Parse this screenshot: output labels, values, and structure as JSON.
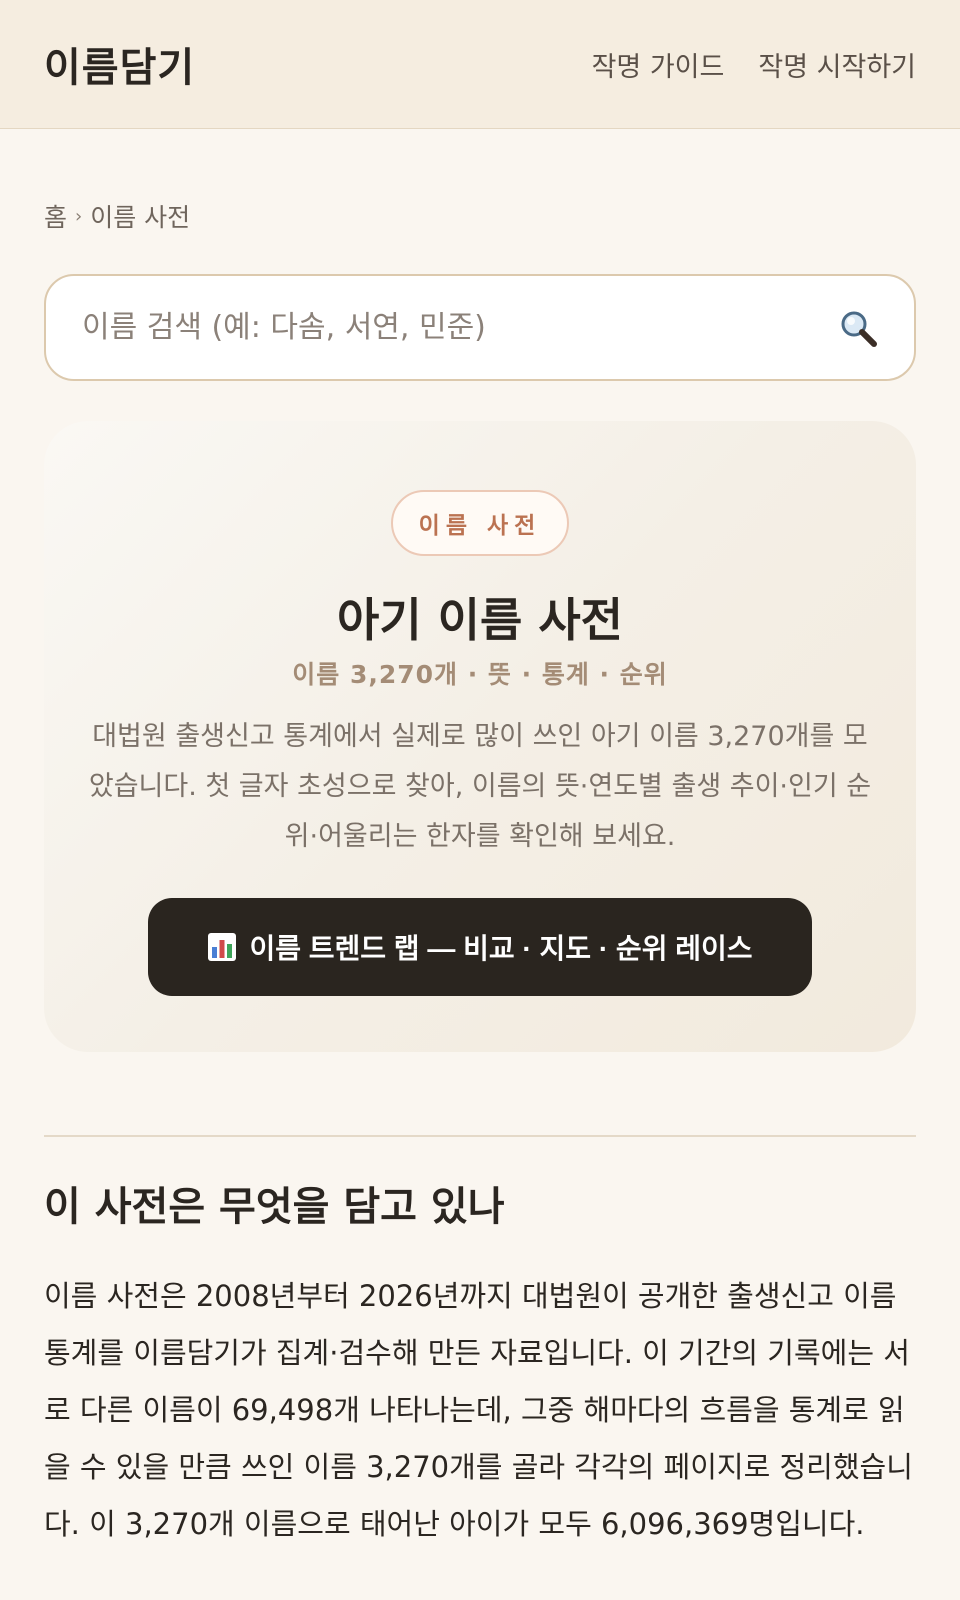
{
  "header": {
    "logo": "이름담기",
    "nav": [
      "작명 가이드",
      "작명 시작하기"
    ]
  },
  "breadcrumb": {
    "home": "홈",
    "separator": "›",
    "current": "이름 사전"
  },
  "search": {
    "placeholder": "이름 검색 (예: 다솜, 서연, 민준)",
    "icon": "search-icon"
  },
  "hero": {
    "badge": "이름 사전",
    "title": "아기 이름 사전",
    "subtitle": "이름 3,270개 · 뜻 · 통계 · 순위",
    "description": "대법원 출생신고 통계에서 실제로 많이 쓰인 아기 이름 3,270개를 모았습니다. 첫 글자 초성으로 찾아, 이름의 뜻·연도별 출생 추이·인기 순위·어울리는 한자를 확인해 보세요.",
    "cta_label": "이름 트렌드 랩 — 비교 · 지도 · 순위 레이스",
    "cta_icon": "bar-chart-icon"
  },
  "section": {
    "title": "이 사전은 무엇을 담고 있나",
    "body": "이름 사전은 2008년부터 2026년까지 대법원이 공개한 출생신고 이름 통계를 이름담기가 집계·검수해 만든 자료입니다. 이 기간의 기록에는 서로 다른 이름이 69,498개 나타나는데, 그중 해마다의 흐름을 통계로 읽을 수 있을 만큼 쓰인 이름 3,270개를 골라 각각의 페이지로 정리했습니다. 이 3,270개 이름으로 태어난 아이가 모두 6,096,369명입니다."
  },
  "colors": {
    "header_bg": "#f5ede0",
    "page_bg": "#faf6f0",
    "accent": "#bb7251",
    "cta_bg": "#2a251f"
  }
}
